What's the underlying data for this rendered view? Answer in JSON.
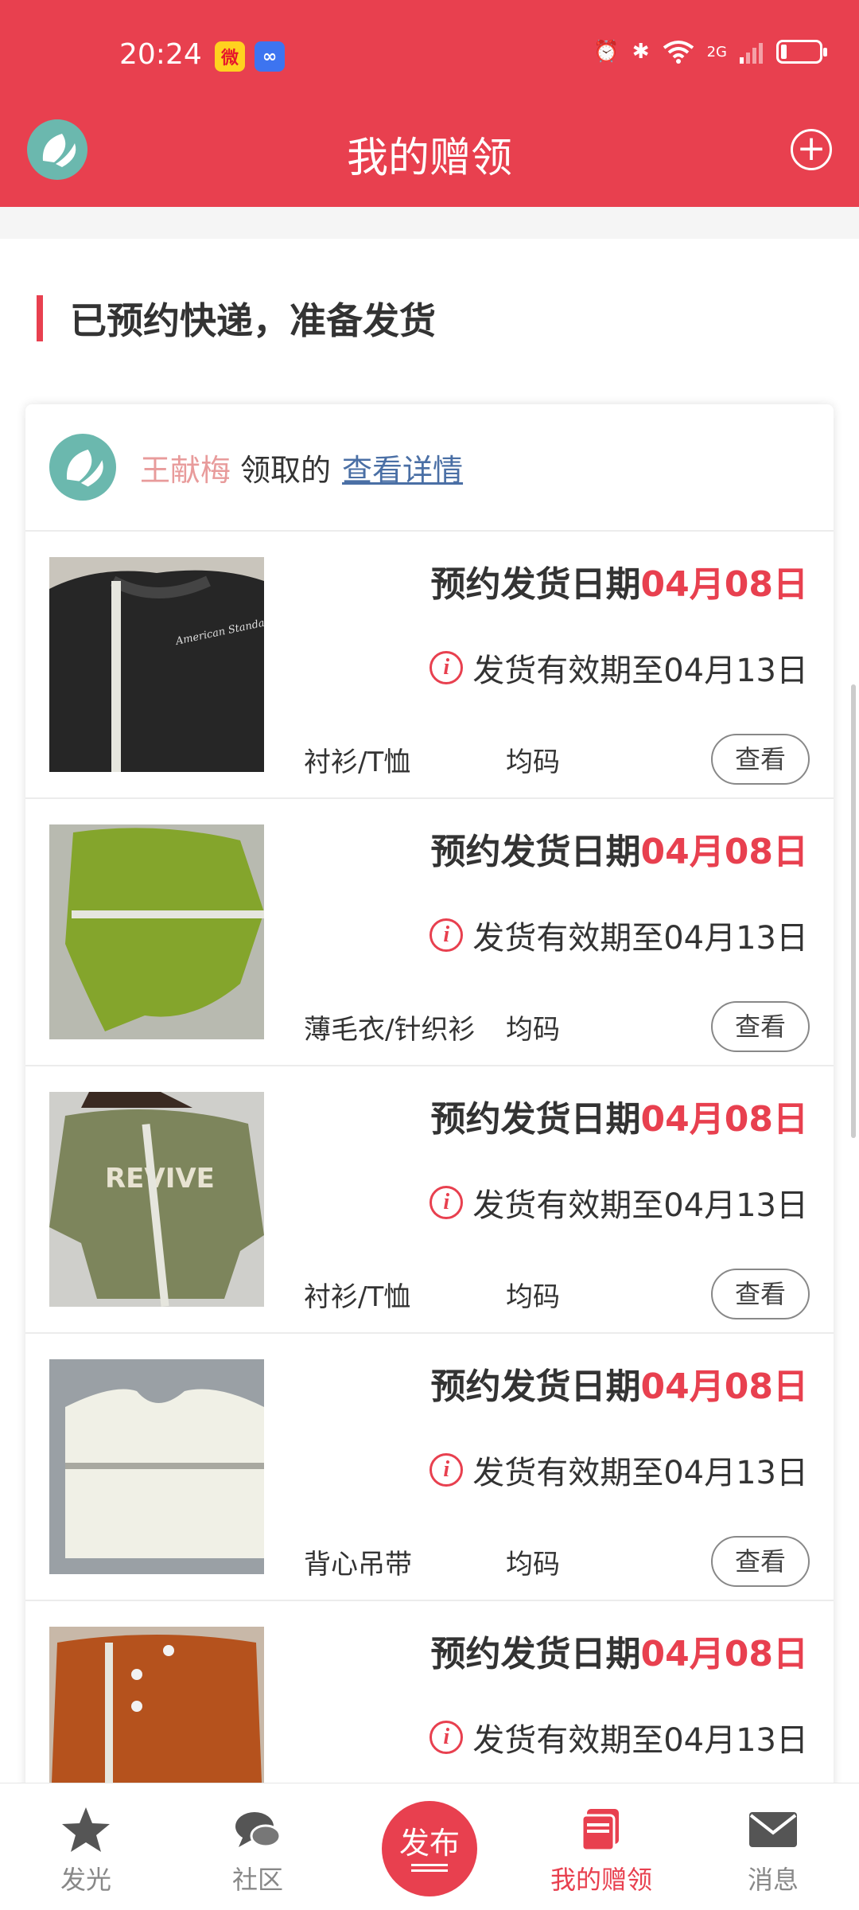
{
  "status_bar": {
    "time": "20:24",
    "network": "2G",
    "battery_level": 0.15
  },
  "header": {
    "title": "我的赠领",
    "add_icon": "plus-circle-icon"
  },
  "section": {
    "title": "已预约快递，准备发货"
  },
  "card": {
    "receiver": "王献梅",
    "received_text": "领取的",
    "detail_link": "查看详情"
  },
  "items": [
    {
      "date_label": "预约发货日期",
      "date": "04月08日",
      "valid_label": "发货有效期至04月13日",
      "category": "衬衫/T恤",
      "size": "均码",
      "view_label": "查看",
      "photo": "black sweatshirt with measuring tape"
    },
    {
      "date_label": "预约发货日期",
      "date": "04月08日",
      "valid_label": "发货有效期至04月13日",
      "category": "薄毛衣/针织衫",
      "size": "均码",
      "view_label": "查看",
      "photo": "green knit sweater with measuring tape"
    },
    {
      "date_label": "预约发货日期",
      "date": "04月08日",
      "valid_label": "发货有效期至04月13日",
      "category": "衬衫/T恤",
      "size": "均码",
      "view_label": "查看",
      "photo": "olive sweatshirt with REVIVE print"
    },
    {
      "date_label": "预约发货日期",
      "date": "04月08日",
      "valid_label": "发货有效期至04月13日",
      "category": "背心吊带",
      "size": "均码",
      "view_label": "查看",
      "photo": "white tank top with measuring tape"
    },
    {
      "date_label": "预约发货日期",
      "date": "04月08日",
      "valid_label": "发货有效期至04月13日",
      "category": "",
      "size": "",
      "view_label": "",
      "photo": "orange shirt with measuring tape"
    }
  ],
  "tabs": [
    {
      "label": "发光",
      "icon": "star-icon"
    },
    {
      "label": "社区",
      "icon": "chat-bubbles-icon"
    },
    {
      "label": "发布",
      "icon": "publish-icon"
    },
    {
      "label": "我的赠领",
      "icon": "gift-stack-icon",
      "active": true
    },
    {
      "label": "消息",
      "icon": "envelope-icon"
    }
  ],
  "colors": {
    "brand_red": "#e8404f",
    "receiver_pink": "#e89b9b",
    "link_blue": "#4a6fa5"
  }
}
